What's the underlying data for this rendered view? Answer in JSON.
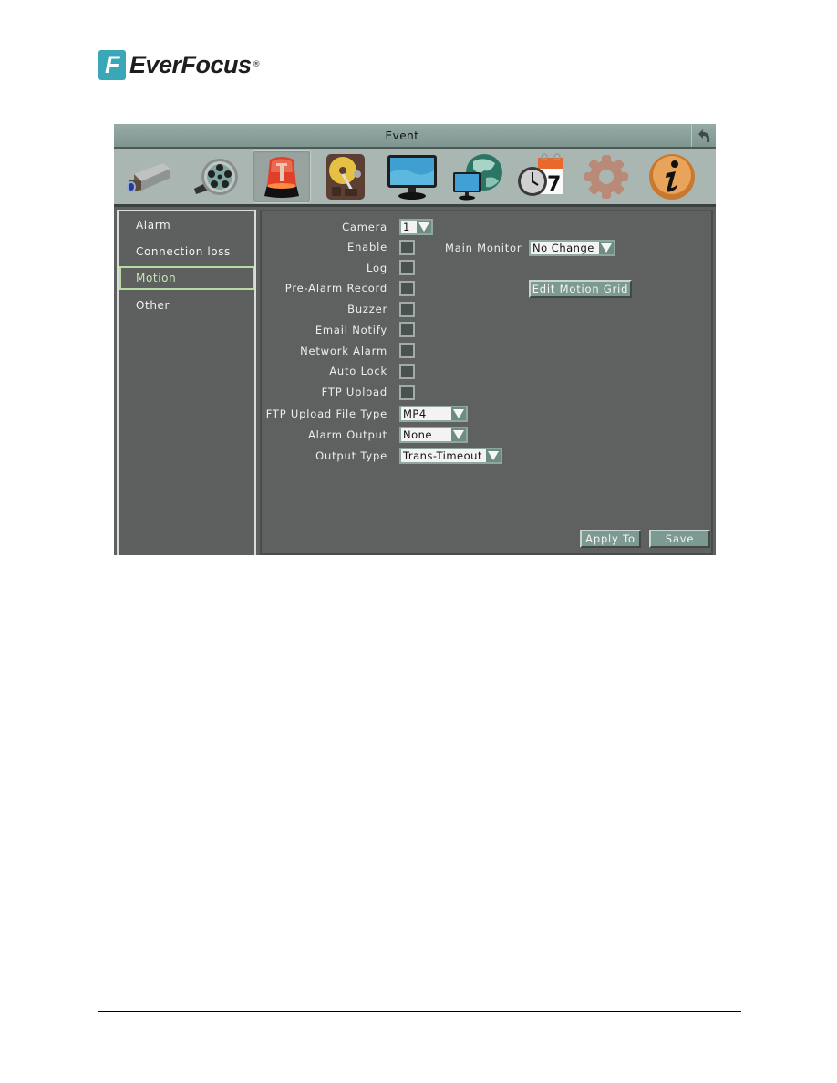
{
  "brand": {
    "name": "EverFocus",
    "mark_letter": "F",
    "registered": "®",
    "color": "#3aa7b8"
  },
  "window": {
    "title": "Event",
    "back_icon": "back-arrow-icon"
  },
  "toolbar": [
    {
      "id": "camera",
      "icon": "camera-icon",
      "active": false
    },
    {
      "id": "record",
      "icon": "film-reel-icon",
      "active": false
    },
    {
      "id": "event",
      "icon": "alarm-siren-icon",
      "active": true
    },
    {
      "id": "disk",
      "icon": "hard-disk-icon",
      "active": false
    },
    {
      "id": "display",
      "icon": "monitor-icon",
      "active": false
    },
    {
      "id": "network",
      "icon": "network-globe-icon",
      "active": false
    },
    {
      "id": "schedule",
      "icon": "clock-calendar-icon",
      "active": false
    },
    {
      "id": "system",
      "icon": "gear-icon",
      "active": false
    },
    {
      "id": "info",
      "icon": "info-icon",
      "active": false
    }
  ],
  "sidebar": {
    "items": [
      {
        "label": "Alarm",
        "active": false
      },
      {
        "label": "Connection loss",
        "active": false
      },
      {
        "label": "Motion",
        "active": true
      },
      {
        "label": "Other",
        "active": false
      }
    ]
  },
  "form": {
    "camera": {
      "label": "Camera",
      "value": "1"
    },
    "enable": {
      "label": "Enable",
      "checked": false
    },
    "log": {
      "label": "Log",
      "checked": false
    },
    "pre_alarm_record": {
      "label": "Pre-Alarm Record",
      "checked": false
    },
    "buzzer": {
      "label": "Buzzer",
      "checked": false
    },
    "email_notify": {
      "label": "Email Notify",
      "checked": false
    },
    "network_alarm": {
      "label": "Network Alarm",
      "checked": false
    },
    "auto_lock": {
      "label": "Auto Lock",
      "checked": false
    },
    "ftp_upload": {
      "label": "FTP Upload",
      "checked": false
    },
    "ftp_upload_file_type": {
      "label": "FTP Upload File Type",
      "value": "MP4"
    },
    "alarm_output": {
      "label": "Alarm Output",
      "value": "None"
    },
    "output_type": {
      "label": "Output Type",
      "value": "Trans-Timeout"
    },
    "main_monitor": {
      "label": "Main Monitor",
      "value": "No Change"
    },
    "edit_motion_grid": "Edit Motion Grid"
  },
  "buttons": {
    "apply_to": "Apply To",
    "save": "Save"
  }
}
